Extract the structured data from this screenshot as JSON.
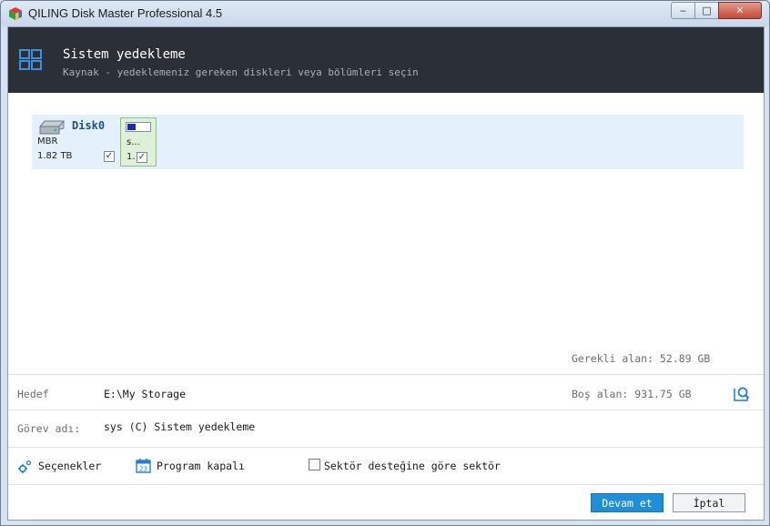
{
  "window": {
    "title": "QILING Disk Master Professional 4.5",
    "min_glyph": "‒",
    "max_glyph": "□",
    "close_glyph": "✕"
  },
  "header": {
    "title": "Sistem yedekleme",
    "subtitle": "Kaynak - yedeklemeniz gereken diskleri veya bölümleri seçin",
    "icon": "grid-icon"
  },
  "disk": {
    "name": "Disk0",
    "type": "MBR",
    "size": "1.82 TB",
    "checked": true,
    "partition": {
      "name": "s...",
      "size": "1.",
      "checked": true,
      "fill_fraction": 0.35
    }
  },
  "space": {
    "required": "Gerekli alan: 52.89 GB",
    "free": "Boş alan: 931.75 GB"
  },
  "target": {
    "label": "Hedef",
    "value": "E:\\My Storage"
  },
  "task": {
    "label": "Görev adı:",
    "value": "sys (C) Sistem yedekleme"
  },
  "options": {
    "settings_label": "Seçenekler",
    "schedule_label": "Program kapalı",
    "sector_label": "Sektör desteğine göre sektör",
    "sector_checked": false
  },
  "buttons": {
    "next": "Devam et",
    "cancel": "İptal"
  },
  "colors": {
    "header_bg": "#2b2f36",
    "accent": "#1f8fd8",
    "disk_row_bg": "#e4f0fb",
    "partition_bg": "#dff0d8"
  }
}
